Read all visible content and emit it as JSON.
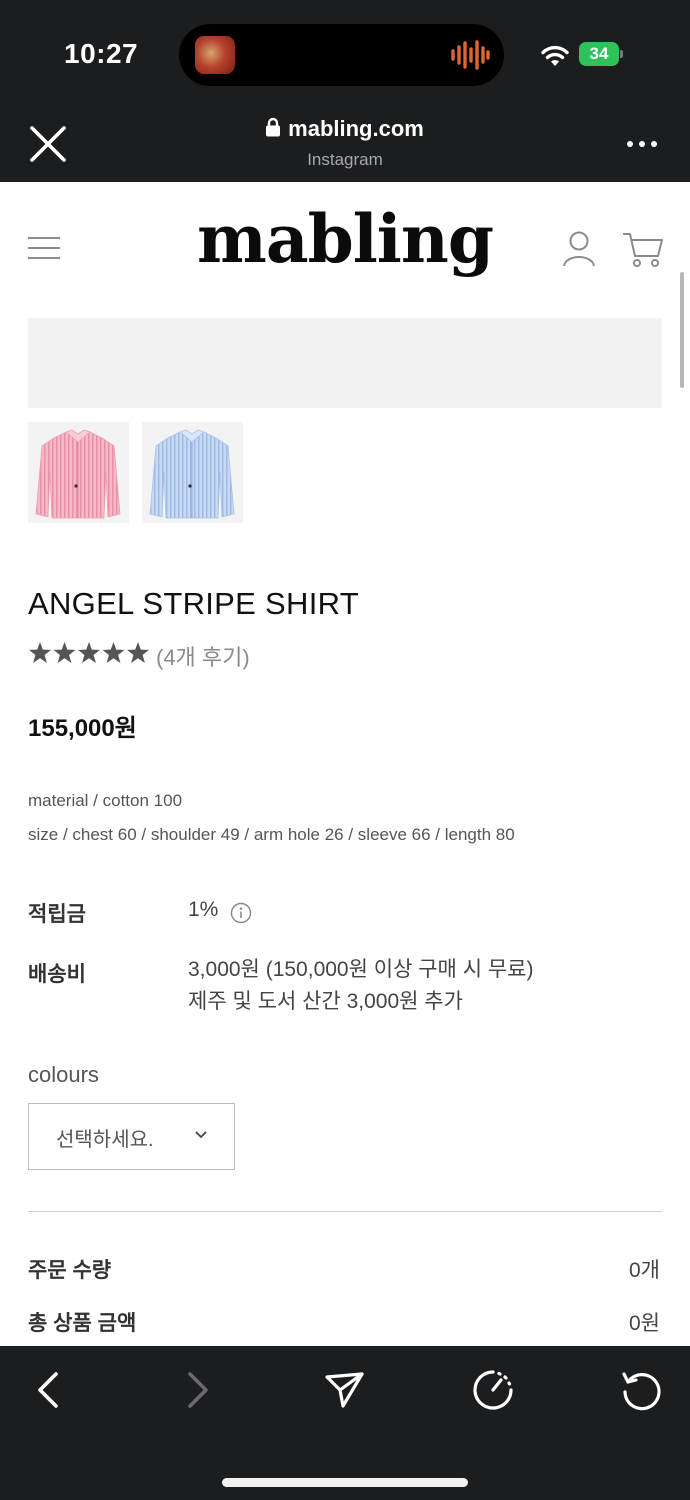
{
  "status_bar": {
    "time": "10:27",
    "battery": "34"
  },
  "browser": {
    "url": "mabling.com",
    "source": "Instagram"
  },
  "site": {
    "logo": "mabling"
  },
  "product": {
    "title": "ANGEL STRIPE SHIRT",
    "rating": 5,
    "review_count": "(4개 후기)",
    "price": "155,000원",
    "material": "material / cotton 100",
    "size": "size / chest 60 / shoulder 49 / arm hole 26 / sleeve 66 / length 80",
    "thumbnails": [
      "pink-stripe-shirt",
      "blue-stripe-shirt"
    ]
  },
  "info": {
    "points_label": "적립금",
    "points_value": "1%",
    "shipping_label": "배송비",
    "shipping_line1": "3,000원 (150,000원 이상 구매 시 무료)",
    "shipping_line2": "제주 및 도서 산간 3,000원 추가"
  },
  "options": {
    "colours_label": "colours",
    "colours_selected": "선택하세요."
  },
  "summary": {
    "qty_label": "주문 수량",
    "qty_value": "0개",
    "total_label": "총 상품 금액",
    "total_value": "0원"
  },
  "colors": {
    "browser_chrome": "#1c1d1f",
    "battery_green": "#2fc15a",
    "audio_wave": "#e0672f"
  }
}
